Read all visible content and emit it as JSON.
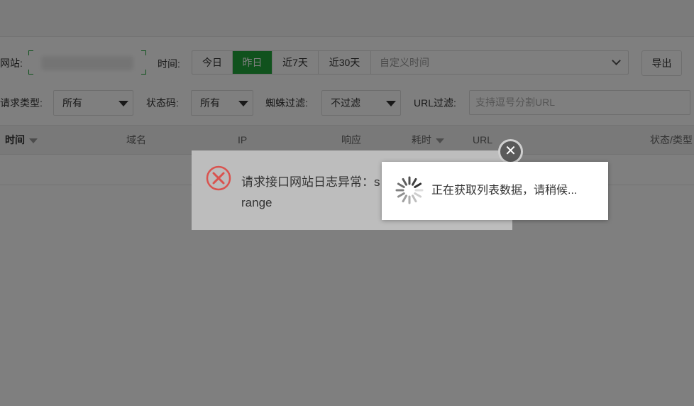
{
  "filters": {
    "site_label": "网站:",
    "time_label": "时间:",
    "time_options": [
      "今日",
      "昨日",
      "近7天",
      "近30天"
    ],
    "time_active": "昨日",
    "custom_time_placeholder": "自定义时间",
    "export_label": "导出",
    "request_type_label": "请求类型:",
    "request_type_value": "所有",
    "status_code_label": "状态码:",
    "status_code_value": "所有",
    "spider_label": "蜘蛛过滤:",
    "spider_value": "不过滤",
    "url_filter_label": "URL过滤:",
    "url_filter_placeholder": "支持逗号分割URL"
  },
  "table": {
    "columns": [
      "时间",
      "域名",
      "IP",
      "响应",
      "耗时",
      "URL",
      "状态/类型"
    ]
  },
  "error_dialog": {
    "message_line1": "请求接口网站日志异常：s",
    "message_line2": "range",
    "close_symbol": "✕"
  },
  "loading_dialog": {
    "message": "正在获取列表数据，请稍候..."
  },
  "colors": {
    "accent": "#20a53a",
    "error": "#d9534f"
  }
}
